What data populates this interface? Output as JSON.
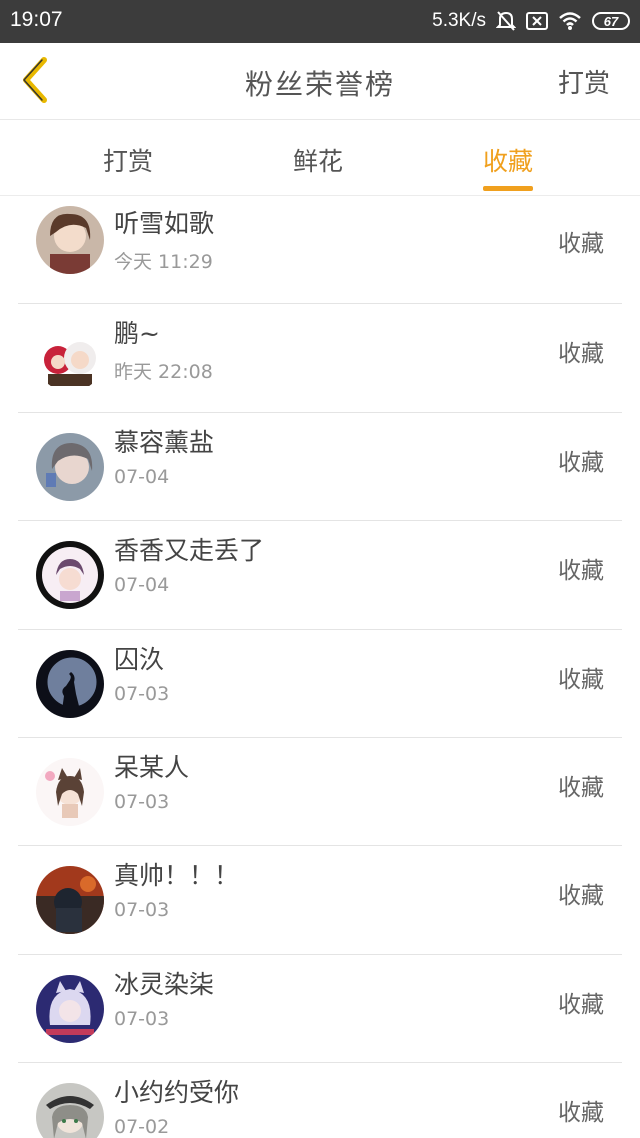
{
  "status_bar": {
    "time": "19:07",
    "net_speed": "5.3K/s",
    "battery": "67",
    "icons": [
      "bell-muted-icon",
      "sim-off-icon",
      "wifi-icon",
      "battery-icon"
    ]
  },
  "header": {
    "back_icon": "chevron-left-icon",
    "title": "粉丝荣誉榜",
    "action": "打赏"
  },
  "tabs": [
    {
      "label": "打赏",
      "active": false
    },
    {
      "label": "鲜花",
      "active": false
    },
    {
      "label": "收藏",
      "active": true
    }
  ],
  "colors": {
    "accent": "#f0a01e",
    "status_bar": "#3c3c3c"
  },
  "fans": [
    {
      "name": "听雪如歌",
      "time": "今天 11:29",
      "action": "收藏"
    },
    {
      "name": "鹏~",
      "time": "昨天 22:08",
      "action": "收藏"
    },
    {
      "name": "慕容薰盐",
      "time": "07-04",
      "action": "收藏"
    },
    {
      "name": "香香又走丢了",
      "time": "07-04",
      "action": "收藏"
    },
    {
      "name": "囚汣",
      "time": "07-03",
      "action": "收藏"
    },
    {
      "name": "呆某人",
      "time": "07-03",
      "action": "收藏"
    },
    {
      "name": "真帅！！！",
      "time": "07-03",
      "action": "收藏"
    },
    {
      "name": "冰灵染柒",
      "time": "07-03",
      "action": "收藏"
    },
    {
      "name": "小约约受你",
      "time": "07-02",
      "action": "收藏"
    }
  ]
}
